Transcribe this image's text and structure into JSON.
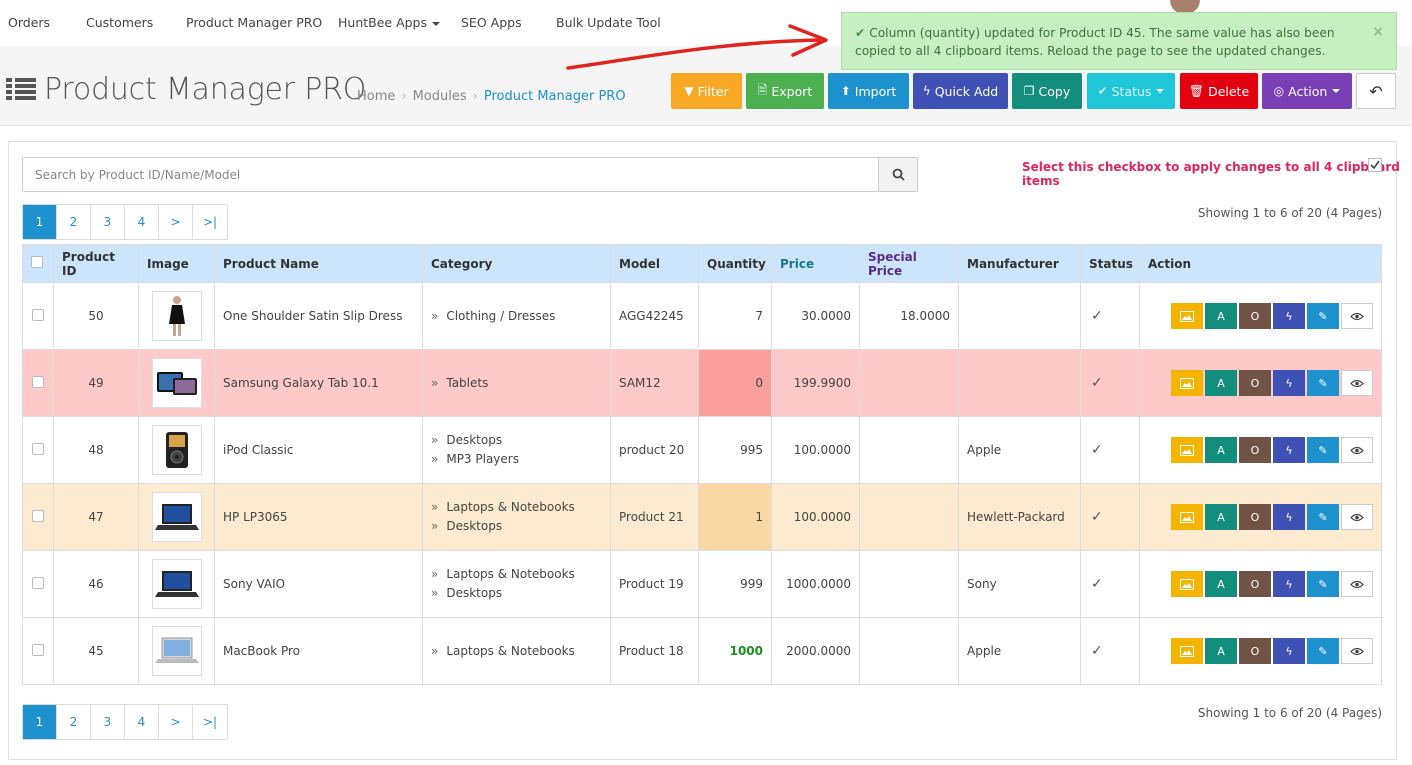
{
  "nav": {
    "items": [
      "Orders",
      "Customers",
      "Product Manager PRO",
      "HuntBee Apps",
      "SEO Apps",
      "Bulk Update Tool"
    ]
  },
  "alert": {
    "text": "Column (quantity) updated for Product ID 45. The same value has also been copied to all 4 clipboard items. Reload the page to see the updated changes.",
    "close": "×"
  },
  "header": {
    "title": "Product Manager PRO",
    "breadcrumb": [
      "Home",
      "Modules",
      "Product Manager PRO"
    ]
  },
  "toolbar": {
    "filter": "Filter",
    "export": "Export",
    "import": "Import",
    "quick_add": "Quick Add",
    "copy": "Copy",
    "status": "Status",
    "delete": "Delete",
    "action": "Action",
    "colors": {
      "filter": "#f9a825",
      "export": "#4caf50",
      "import": "#1e91cf",
      "quick_add": "#3f51b5",
      "copy": "#138d7c",
      "status": "#1ec6d8",
      "delete": "#e3000f",
      "action": "#7b3fb5"
    }
  },
  "search": {
    "placeholder": "Search by Product ID/Name/Model"
  },
  "clipboard_note": "Select this checkbox to apply changes to all 4 clipboard items",
  "pagination": {
    "pages": [
      "1",
      "2",
      "3",
      "4",
      ">",
      ">|"
    ],
    "active": "1",
    "showing": "Showing 1 to 6 of 20 (4 Pages)"
  },
  "table": {
    "headers": {
      "product_id": "Product ID",
      "image": "Image",
      "product_name": "Product Name",
      "category": "Category",
      "model": "Model",
      "quantity": "Quantity",
      "price": "Price",
      "special_price": "Special Price",
      "manufacturer": "Manufacturer",
      "status": "Status",
      "action": "Action"
    },
    "rows": [
      {
        "id": "50",
        "image": "dress-image",
        "name": "One Shoulder Satin Slip Dress",
        "categories": [
          "Clothing / Dresses"
        ],
        "model": "AGG42245",
        "quantity": "7",
        "price": "30.0000",
        "special_price": "18.0000",
        "manufacturer": "",
        "status": "✓",
        "highlight": "none"
      },
      {
        "id": "49",
        "image": "tablet-image",
        "name": "Samsung Galaxy Tab 10.1",
        "categories": [
          "Tablets"
        ],
        "model": "SAM12",
        "quantity": "0",
        "price": "199.9900",
        "special_price": "",
        "manufacturer": "",
        "status": "✓",
        "highlight": "red"
      },
      {
        "id": "48",
        "image": "ipod-image",
        "name": "iPod Classic",
        "categories": [
          "Desktops",
          "MP3 Players"
        ],
        "model": "product 20",
        "quantity": "995",
        "price": "100.0000",
        "special_price": "",
        "manufacturer": "Apple",
        "status": "✓",
        "highlight": "none"
      },
      {
        "id": "47",
        "image": "laptop-image",
        "name": "HP LP3065",
        "categories": [
          "Laptops & Notebooks",
          "Desktops"
        ],
        "model": "Product 21",
        "quantity": "1",
        "price": "100.0000",
        "special_price": "",
        "manufacturer": "Hewlett-Packard",
        "status": "✓",
        "highlight": "orange"
      },
      {
        "id": "46",
        "image": "laptop-image",
        "name": "Sony VAIO",
        "categories": [
          "Laptops & Notebooks",
          "Desktops"
        ],
        "model": "Product 19",
        "quantity": "999",
        "price": "1000.0000",
        "special_price": "",
        "manufacturer": "Sony",
        "status": "✓",
        "highlight": "none"
      },
      {
        "id": "45",
        "image": "macbook-image",
        "name": "MacBook Pro",
        "categories": [
          "Laptops & Notebooks"
        ],
        "model": "Product 18",
        "quantity": "1000",
        "price": "2000.0000",
        "special_price": "",
        "manufacturer": "Apple",
        "status": "✓",
        "highlight": "none",
        "quantity_updated": true
      }
    ],
    "row_actions": [
      "A",
      "O"
    ]
  }
}
